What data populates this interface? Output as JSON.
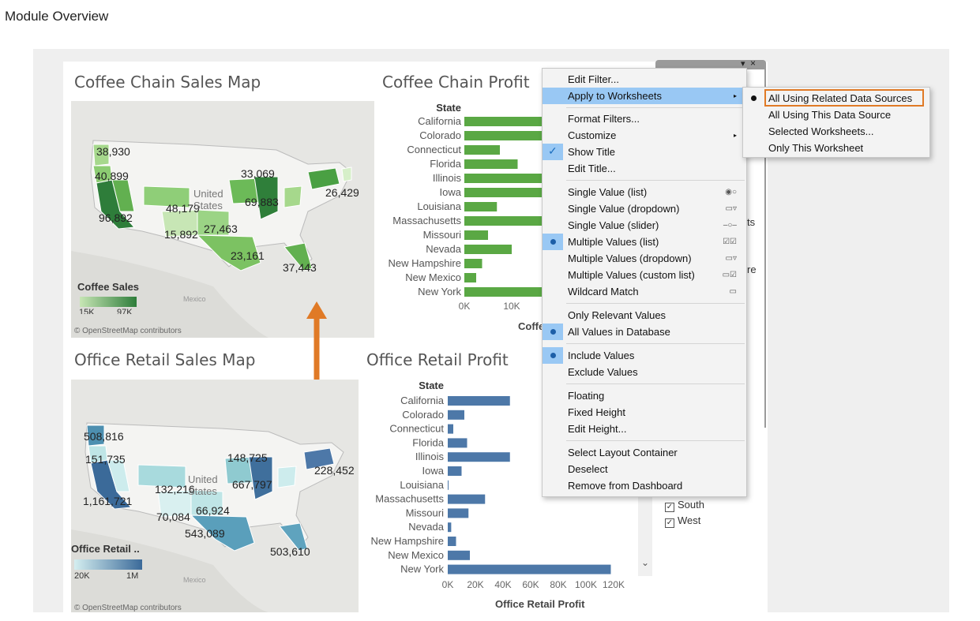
{
  "page_title": "Module Overview",
  "coffee_map": {
    "title": "Coffee Chain Sales Map",
    "labels": [
      "38,930",
      "40,899",
      "33,069",
      "26,429",
      "48,179",
      "69,883",
      "96,892",
      "15,892",
      "27,463",
      "23,161",
      "37,443"
    ],
    "country_label": "United States",
    "mexico": "Mexico",
    "legend_title": "Coffee Sales",
    "legend_min": "15K",
    "legend_max": "97K",
    "attribution": "© OpenStreetMap contributors",
    "colors": {
      "light": "#c7e6b5",
      "dark": "#2e7d3a"
    }
  },
  "office_map": {
    "title": "Office Retail Sales Map",
    "labels": [
      "508,816",
      "151,735",
      "148,725",
      "228,452",
      "132,216",
      "667,797",
      "1,161,721",
      "70,084",
      "66,924",
      "543,089",
      "503,610"
    ],
    "country_label": "United States",
    "mexico": "Mexico",
    "legend_title": "Office Retail ..",
    "legend_min": "20K",
    "legend_max": "1M",
    "attribution": "© OpenStreetMap contributors",
    "colors": {
      "light": "#d4eef0",
      "dark": "#3b6a99"
    }
  },
  "chart_data": [
    {
      "type": "bar",
      "title": "Coffee Chain Profit",
      "column_header": "State",
      "categories": [
        "California",
        "Colorado",
        "Connecticut",
        "Florida",
        "Illinois",
        "Iowa",
        "Louisiana",
        "Massachusetts",
        "Missouri",
        "Nevada",
        "New Hampshire",
        "New Mexico",
        "New York"
      ],
      "values": [
        22000,
        20000,
        6000,
        9000,
        20000,
        20000,
        5500,
        20000,
        4000,
        8000,
        3000,
        2000,
        20000
      ],
      "xticks": [
        "0K",
        "10K"
      ],
      "xlabel": "Coffe",
      "color": "#5aa844"
    },
    {
      "type": "bar",
      "title": "Office Retail Profit",
      "column_header": "State",
      "categories": [
        "California",
        "Colorado",
        "Connecticut",
        "Florida",
        "Illinois",
        "Iowa",
        "Louisiana",
        "Massachusetts",
        "Missouri",
        "Nevada",
        "New Hampshire",
        "New Mexico",
        "New York"
      ],
      "values": [
        45000,
        12000,
        4000,
        14000,
        45000,
        10000,
        500,
        27000,
        15000,
        2500,
        6000,
        16000,
        118000
      ],
      "xticks": [
        "0K",
        "20K",
        "40K",
        "60K",
        "80K",
        "100K",
        "120K"
      ],
      "xlabel": "Office Retail Profit",
      "xlim": [
        0,
        120000
      ],
      "color": "#4d78a8"
    }
  ],
  "filter_panel": {
    "partial_1": "ts",
    "partial_2": "re",
    "options": [
      {
        "label": "South",
        "checked": true
      },
      {
        "label": "West",
        "checked": true
      }
    ],
    "scroll_down": "⌄"
  },
  "context_menu": {
    "items": [
      {
        "label": "Edit Filter...",
        "icon": "",
        "mark": "",
        "submenu": false
      },
      {
        "label": "Apply to Worksheets",
        "icon": "",
        "mark": "",
        "submenu": true,
        "highlighted": true
      },
      {
        "label": "Format Filters...",
        "icon": "",
        "mark": "",
        "submenu": false
      },
      {
        "label": "Customize",
        "icon": "",
        "mark": "",
        "submenu": true
      },
      {
        "label": "Show Title",
        "icon": "",
        "mark": "check",
        "submenu": false
      },
      {
        "label": "Edit Title...",
        "icon": "",
        "mark": "",
        "submenu": false
      },
      {
        "label": "Single Value (list)",
        "icon": "◉○",
        "mark": "",
        "submenu": false
      },
      {
        "label": "Single Value (dropdown)",
        "icon": "▭▿",
        "mark": "",
        "submenu": false
      },
      {
        "label": "Single Value (slider)",
        "icon": "–○–",
        "mark": "",
        "submenu": false
      },
      {
        "label": "Multiple Values (list)",
        "icon": "☑☑",
        "mark": "dot",
        "submenu": false
      },
      {
        "label": "Multiple Values (dropdown)",
        "icon": "▭▿",
        "mark": "",
        "submenu": false
      },
      {
        "label": "Multiple Values (custom list)",
        "icon": "▭☑",
        "mark": "",
        "submenu": false
      },
      {
        "label": "Wildcard Match",
        "icon": "▭",
        "mark": "",
        "submenu": false
      },
      {
        "label": "Only Relevant Values",
        "icon": "",
        "mark": "",
        "submenu": false
      },
      {
        "label": "All Values in Database",
        "icon": "",
        "mark": "dot",
        "submenu": false
      },
      {
        "label": "Include Values",
        "icon": "",
        "mark": "dot",
        "submenu": false
      },
      {
        "label": "Exclude Values",
        "icon": "",
        "mark": "",
        "submenu": false
      },
      {
        "label": "Floating",
        "icon": "",
        "mark": "",
        "submenu": false
      },
      {
        "label": "Fixed Height",
        "icon": "",
        "mark": "",
        "submenu": false
      },
      {
        "label": "Edit Height...",
        "icon": "",
        "mark": "",
        "submenu": false
      },
      {
        "label": "Select Layout Container",
        "icon": "",
        "mark": "",
        "submenu": false
      },
      {
        "label": "Deselect",
        "icon": "",
        "mark": "",
        "submenu": false
      },
      {
        "label": "Remove from Dashboard",
        "icon": "",
        "mark": "",
        "submenu": false
      }
    ],
    "submenu_arrow": "▸"
  },
  "submenu": {
    "items": [
      {
        "label": "All Using Related Data Sources",
        "selected": true
      },
      {
        "label": "All Using This Data Source",
        "selected": false
      },
      {
        "label": "Selected Worksheets...",
        "selected": false
      },
      {
        "label": "Only This Worksheet",
        "selected": false
      }
    ],
    "highlight_color": "#e07a26"
  },
  "filter_tab_icons": {
    "dropdown": "▾",
    "close": "×"
  },
  "arrow_color": "#e07a26"
}
